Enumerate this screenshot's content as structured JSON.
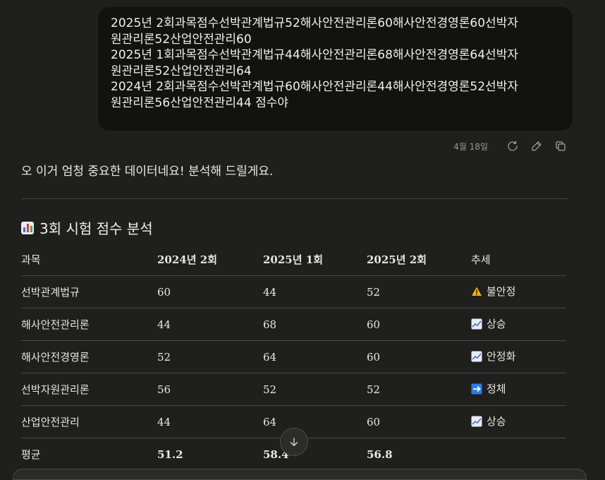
{
  "user_message": {
    "lines": [
      "2025년 2회과목점수선박관계법규52해사안전관리론60해사안전경영론60선박자",
      "원관리론52산업안전관리60",
      "2025년 1회과목점수선박관계법규44해사안전관리론68해사안전경영론64선박자",
      "원관리론52산업안전관리64",
      "2024년 2회과목점수선박관계법규60해사안전관리론44해사안전경영론52선박자",
      "원관리론56산업안전관리44 점수야"
    ]
  },
  "message_meta": {
    "date": "4월 18일",
    "retry_icon": "retry-icon",
    "edit_icon": "pencil-icon",
    "copy_icon": "copy-icon"
  },
  "assistant": {
    "intro": "오 이거 엄청 중요한 데이터네요! 분석해 드릴게요.",
    "section_title": "3회 시험 점수 분석",
    "section_icon": "bar-chart-emoji",
    "table": {
      "headers": [
        "과목",
        "2024년 2회",
        "2025년 1회",
        "2025년 2회",
        "추세"
      ],
      "rows": [
        {
          "subject": "선박관계법규",
          "v2024_2": "60",
          "v2025_1": "44",
          "v2025_2": "52",
          "trend_icon": "warning-emoji",
          "trend": "불안정"
        },
        {
          "subject": "해사안전관리론",
          "v2024_2": "44",
          "v2025_1": "68",
          "v2025_2": "60",
          "trend_icon": "chart-increasing-emoji",
          "trend": "상승"
        },
        {
          "subject": "해사안전경영론",
          "v2024_2": "52",
          "v2025_1": "64",
          "v2025_2": "60",
          "trend_icon": "chart-increasing-emoji",
          "trend": "안정화"
        },
        {
          "subject": "선박자원관리론",
          "v2024_2": "56",
          "v2025_1": "52",
          "v2025_2": "52",
          "trend_icon": "right-arrow-emoji",
          "trend": "정체"
        },
        {
          "subject": "산업안전관리",
          "v2024_2": "44",
          "v2025_1": "64",
          "v2025_2": "60",
          "trend_icon": "chart-increasing-emoji",
          "trend": "상승"
        }
      ],
      "average": {
        "label": "평균",
        "v2024_2": "51.2",
        "v2025_1": "58.4",
        "v2025_2": "56.8"
      }
    }
  },
  "scroll_button_icon": "arrow-down-icon"
}
